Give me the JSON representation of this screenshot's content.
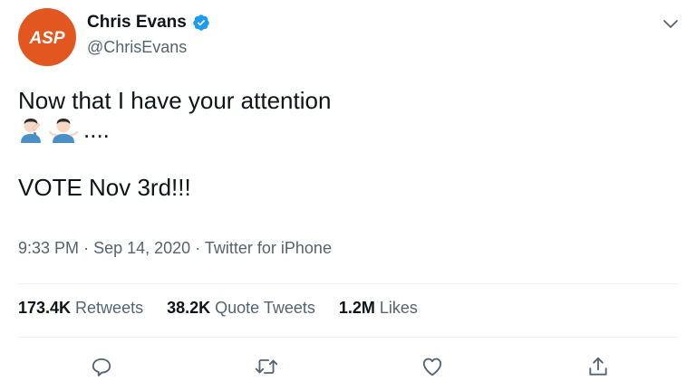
{
  "author": {
    "display_name": "Chris Evans",
    "handle": "@ChrisEvans",
    "avatar_text": "ASP",
    "avatar_color": "#e2561f",
    "verified": true
  },
  "tweet": {
    "line1": "Now that I have your attention",
    "line2_emojis": [
      "man-facepalming-emoji",
      "man-shrugging-emoji"
    ],
    "line2_text": "....",
    "line3": "VOTE Nov 3rd!!!"
  },
  "meta": {
    "time": "9:33 PM",
    "separator": "·",
    "date": "Sep 14, 2020",
    "source": "Twitter for iPhone"
  },
  "stats": {
    "retweets_count": "173.4K",
    "retweets_label": "Retweets",
    "quotes_count": "38.2K",
    "quotes_label": "Quote Tweets",
    "likes_count": "1.2M",
    "likes_label": "Likes"
  },
  "colors": {
    "text": "#0f1419",
    "secondary": "#536471",
    "verified_blue": "#1d9bf0",
    "divider": "#eff3f4"
  },
  "icons": [
    "verified-badge-icon",
    "chevron-down-icon",
    "reply-icon",
    "retweet-icon",
    "like-icon",
    "share-icon"
  ]
}
